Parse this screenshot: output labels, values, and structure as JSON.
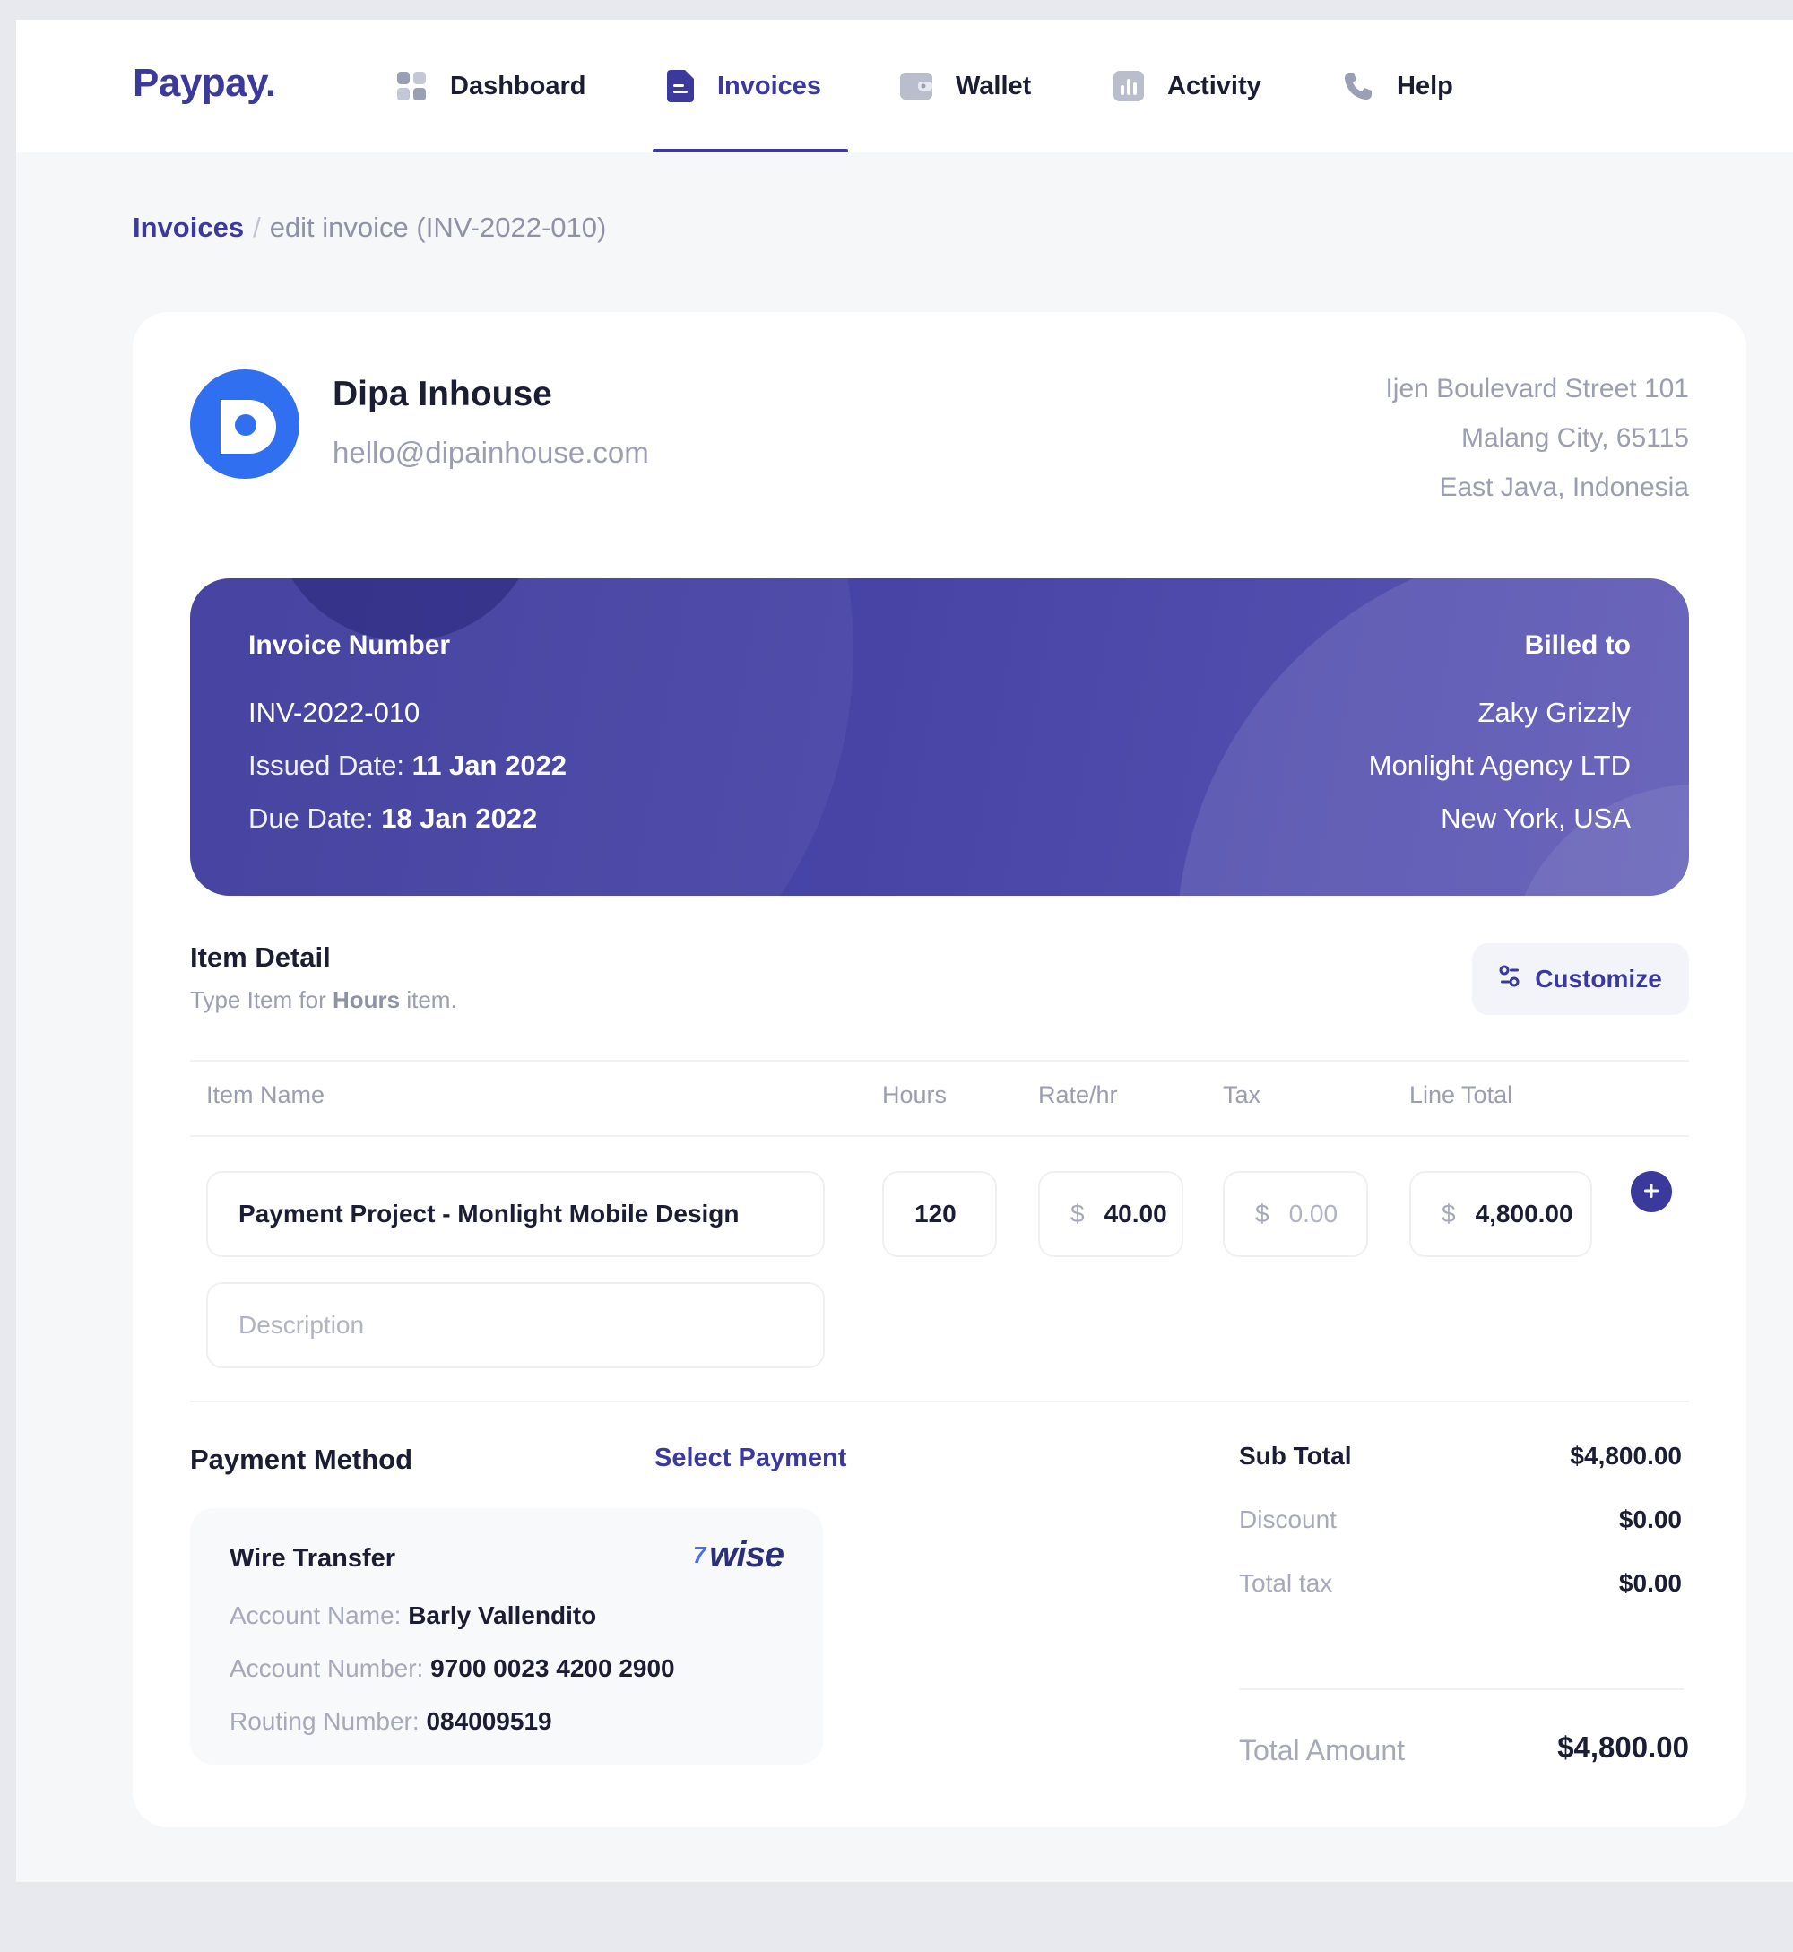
{
  "brand": {
    "logo": "Paypay."
  },
  "nav": {
    "items": [
      {
        "label": "Dashboard",
        "icon": "dashboard-grid-icon"
      },
      {
        "label": "Invoices",
        "icon": "document-icon",
        "active": true
      },
      {
        "label": "Wallet",
        "icon": "wallet-icon"
      },
      {
        "label": "Activity",
        "icon": "chart-icon"
      },
      {
        "label": "Help",
        "icon": "phone-icon"
      }
    ]
  },
  "breadcrumb": {
    "root": "Invoices",
    "separator": "/",
    "current": "edit invoice (INV-2022-010)"
  },
  "company": {
    "name": "Dipa Inhouse",
    "email": "hello@dipainhouse.com",
    "address": [
      "Ijen Boulevard Street 101",
      "Malang City, 65115",
      "East Java, Indonesia"
    ]
  },
  "invoice": {
    "number_label": "Invoice Number",
    "number": "INV-2022-010",
    "issued_label": "Issued Date:",
    "issued_date": "11 Jan 2022",
    "due_label": "Due Date:",
    "due_date": "18 Jan 2022",
    "billed_label": "Billed to",
    "billed_to": [
      "Zaky Grizzly",
      "Monlight Agency LTD",
      "New York, USA"
    ]
  },
  "item_detail": {
    "title": "Item Detail",
    "subtitle_pre": "Type Item for",
    "subtitle_bold": "Hours",
    "subtitle_post": "item.",
    "customize_label": "Customize",
    "columns": {
      "item_name": "Item Name",
      "hours": "Hours",
      "rate": "Rate/hr",
      "tax": "Tax",
      "line_total": "Line Total"
    },
    "item": {
      "name": "Payment Project - Monlight Mobile Design",
      "hours": "120",
      "currency": "$",
      "rate": "40.00",
      "tax": "0.00",
      "line_total": "4,800.00",
      "description_placeholder": "Description"
    }
  },
  "payment": {
    "title": "Payment Method",
    "select_label": "Select Payment",
    "method": "Wire Transfer",
    "provider": "wise",
    "provider_flag": "7",
    "account_name_label": "Account Name:",
    "account_name": "Barly Vallendito",
    "account_number_label": "Account Number:",
    "account_number": "9700 0023 4200 2900",
    "routing_label": "Routing Number:",
    "routing_number": "084009519"
  },
  "totals": {
    "sub_total_label": "Sub Total",
    "sub_total": "$4,800.00",
    "discount_label": "Discount",
    "discount": "$0.00",
    "tax_label": "Total tax",
    "tax": "$0.00",
    "total_label": "Total Amount",
    "total": "$4,800.00"
  },
  "colors": {
    "accent": "#3b3a9c",
    "banner": "#4744a6",
    "company_logo": "#2f6ff0"
  }
}
